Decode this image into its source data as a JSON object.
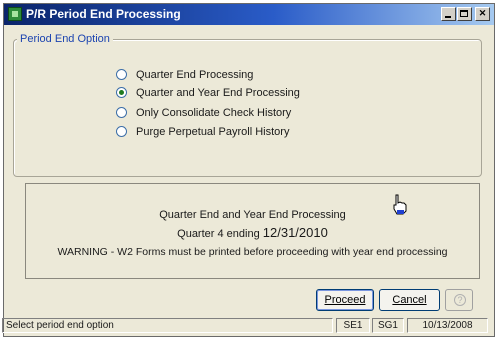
{
  "window": {
    "title": "P/R Period End Processing",
    "controls": {
      "minimize": "–",
      "maximize": "□",
      "close": "✕"
    }
  },
  "period_end_option": {
    "legend": "Period End Option",
    "options": [
      {
        "label": "Quarter End Processing",
        "checked": false
      },
      {
        "label": "Quarter and Year End Processing",
        "checked": true
      },
      {
        "label": "Only Consolidate Check History",
        "checked": false
      },
      {
        "label": "Purge Perpetual Payroll History",
        "checked": false
      }
    ]
  },
  "info": {
    "line1": "Quarter End and Year End Processing",
    "quarter_prefix": "Quarter 4 ending",
    "quarter_date": "12/31/2010",
    "warning": "WARNING - W2 Forms must be printed before proceeding with year end processing"
  },
  "buttons": {
    "proceed": "Proceed",
    "cancel": "Cancel",
    "help": "?"
  },
  "status": {
    "message": "Select period end option",
    "company": "SE1",
    "code": "SG1",
    "date": "10/13/2008"
  },
  "icons": {
    "app": "payroll-app-icon",
    "cursor": "hand-pointer-icon"
  },
  "colors": {
    "title_start": "#0a246a",
    "title_end": "#a6caf0",
    "legend": "#1c44b0",
    "window_bg": "#ece9d8"
  }
}
